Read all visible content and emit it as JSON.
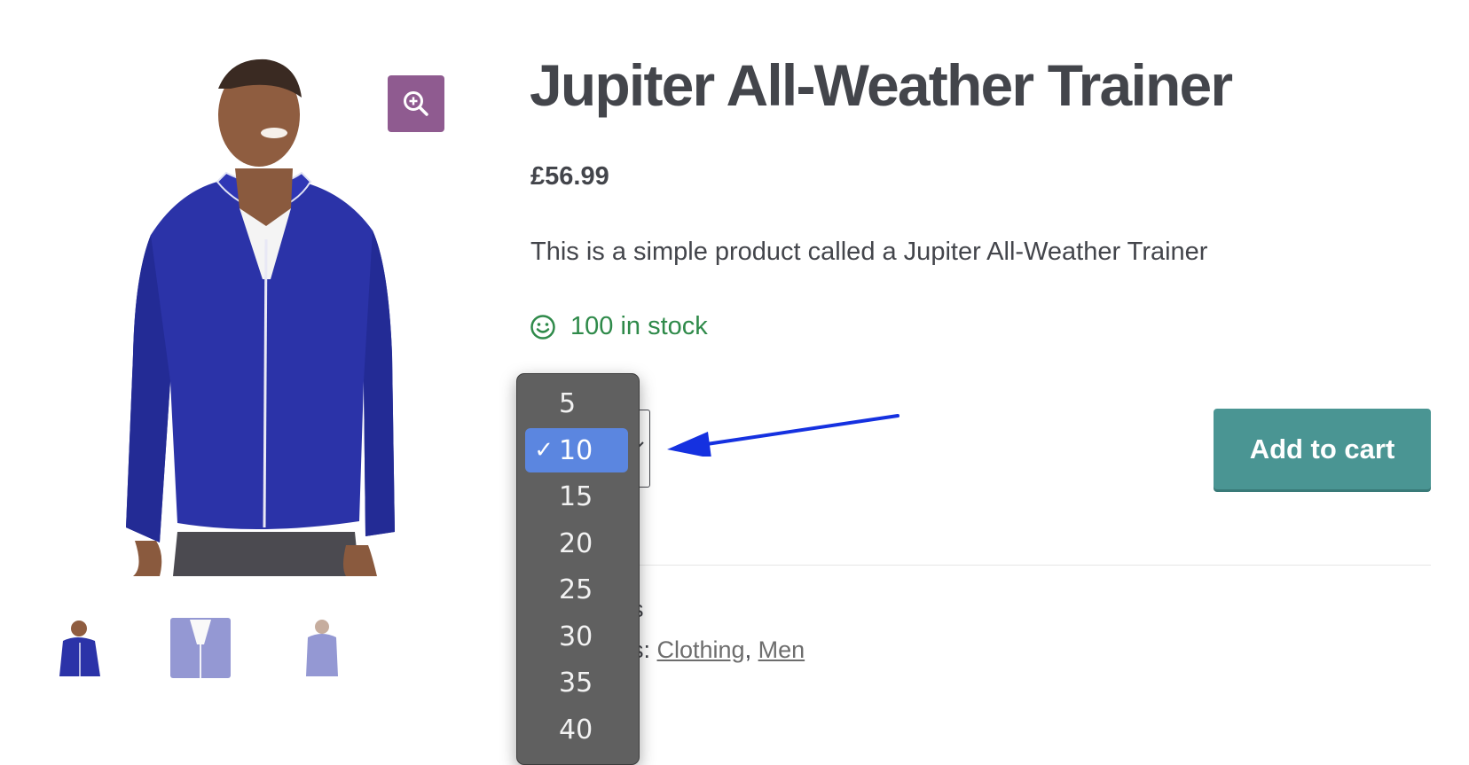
{
  "gallery": {
    "zoom_icon": "magnify-plus-icon",
    "thumbnails": [
      "front-view",
      "detail-view",
      "back-view"
    ]
  },
  "product": {
    "title": "Jupiter All-Weather Trainer",
    "price": "£56.99",
    "description": "This is a simple product called a Jupiter All-Weather Trainer",
    "stock_icon": "smiley-icon",
    "stock_text": "100 in stock",
    "stock_color": "#2f8a4a"
  },
  "cart": {
    "add_label": "Add to cart",
    "button_color": "#4a9593"
  },
  "quantity_dropdown": {
    "check_mark": "✓",
    "selected_value": "10",
    "selected_color": "#5b86e0",
    "options": [
      "5",
      "10",
      "15",
      "20",
      "25",
      "30",
      "35",
      "40"
    ]
  },
  "meta": {
    "sku_fragment": "s",
    "categories_suffix": "s: ",
    "categories": [
      "Clothing",
      "Men"
    ],
    "separator": ", "
  },
  "annotation": {
    "arrow_color": "#1531e0"
  }
}
